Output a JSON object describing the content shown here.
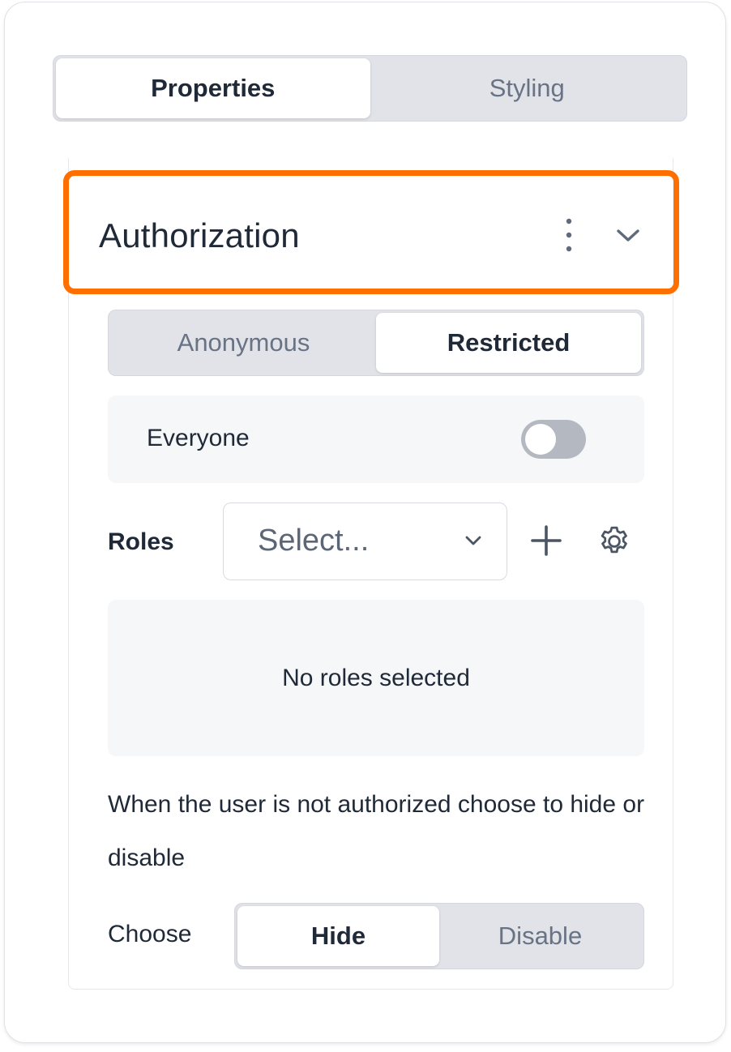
{
  "tabs": {
    "properties": "Properties",
    "styling": "Styling",
    "active": "Properties"
  },
  "section": {
    "title": "Authorization",
    "highlight_color": "#ff6f00"
  },
  "access_mode": {
    "anonymous": "Anonymous",
    "restricted": "Restricted",
    "active": "Restricted"
  },
  "everyone": {
    "label": "Everyone",
    "enabled": false
  },
  "roles": {
    "label": "Roles",
    "select_placeholder": "Select...",
    "empty_text": "No roles selected"
  },
  "unauthorized": {
    "hint": "When the user is not authorized choose to hide or disable",
    "choose_label": "Choose",
    "hide": "Hide",
    "disable": "Disable",
    "active": "Hide"
  },
  "icons": [
    "more-vertical-icon",
    "chevron-down-icon",
    "plus-icon",
    "gear-icon"
  ]
}
